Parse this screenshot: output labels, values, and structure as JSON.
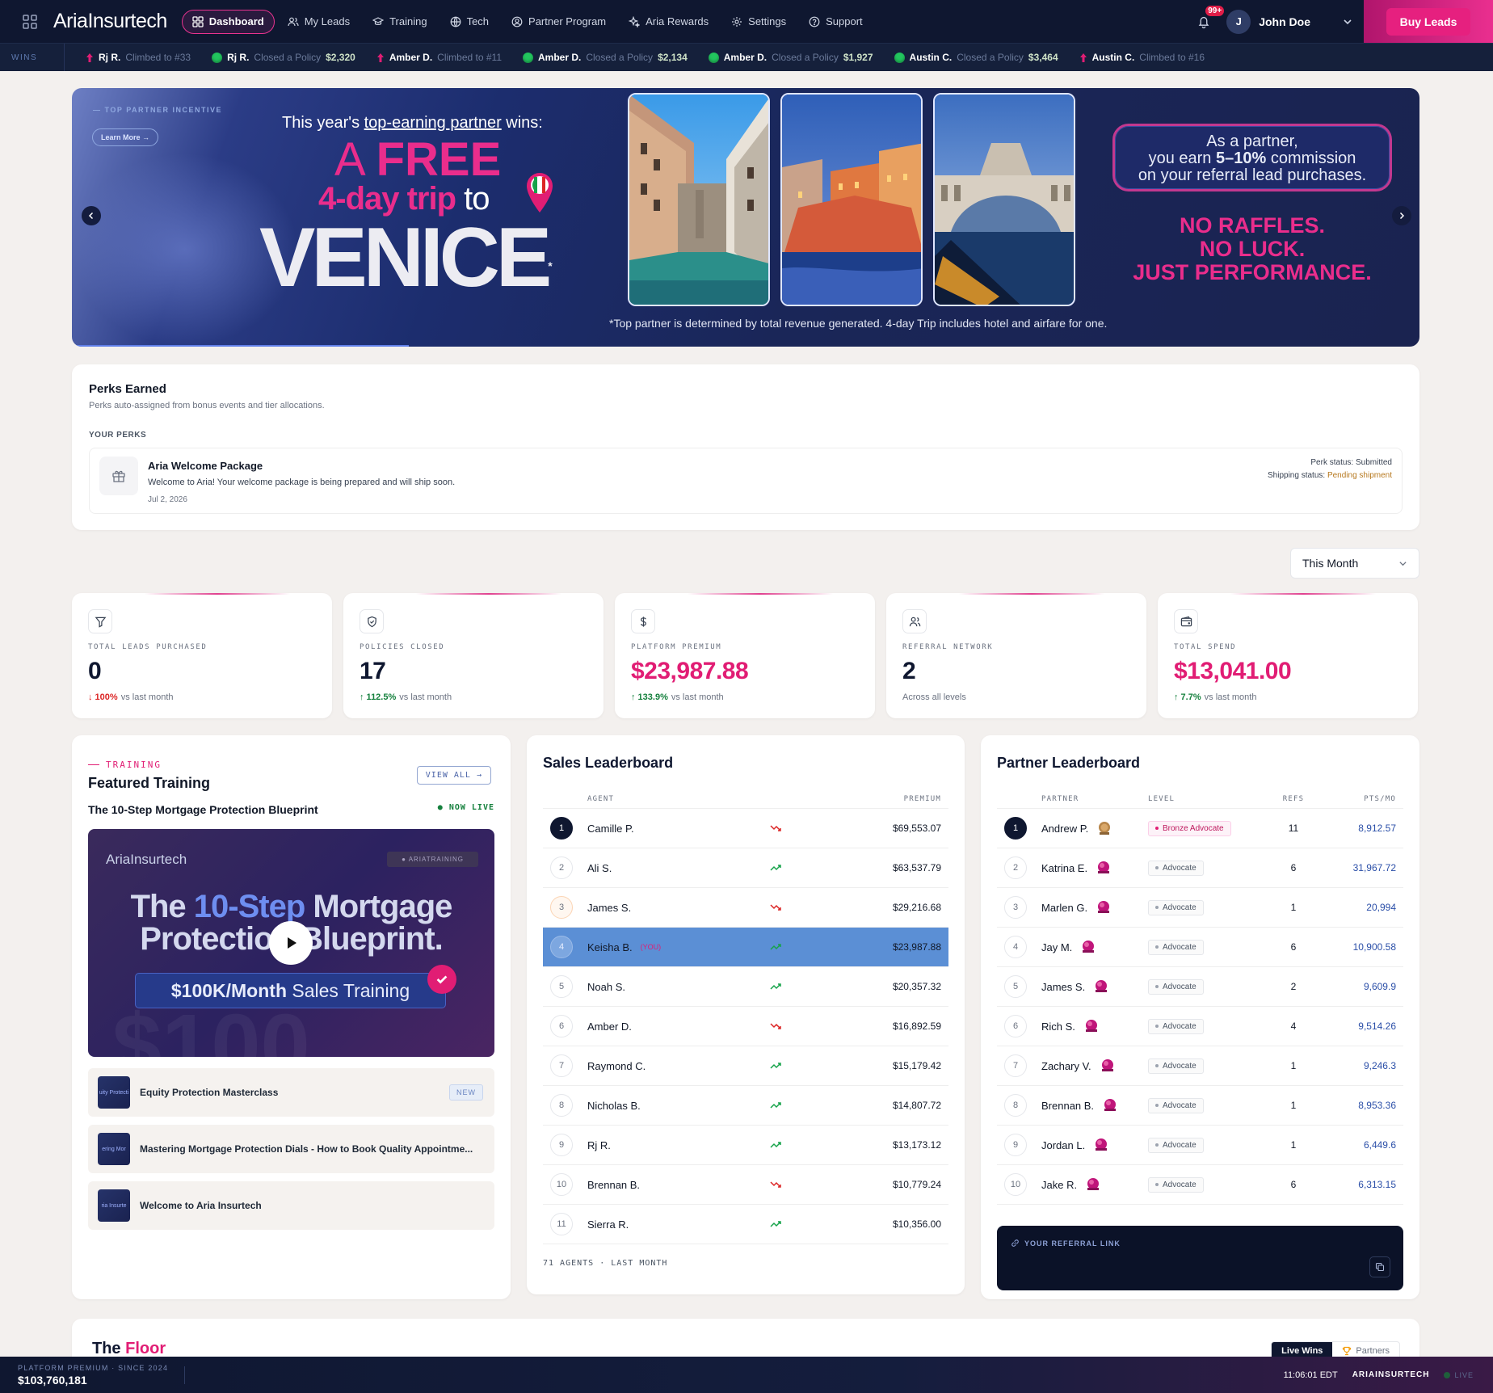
{
  "header": {
    "logo": "AriaInsurtech",
    "nav": [
      {
        "label": "Dashboard",
        "icon": "grid-icon",
        "active": true
      },
      {
        "label": "My Leads",
        "icon": "users-icon"
      },
      {
        "label": "Training",
        "icon": "graduation-icon"
      },
      {
        "label": "Tech",
        "icon": "globe-icon"
      },
      {
        "label": "Partner Program",
        "icon": "partner-icon"
      },
      {
        "label": "Aria Rewards",
        "icon": "sparkle-icon"
      },
      {
        "label": "Settings",
        "icon": "gear-icon"
      },
      {
        "label": "Support",
        "icon": "help-icon"
      }
    ],
    "notifications": "99+",
    "user_initial": "J",
    "user_name": "John Doe",
    "buy_leads": "Buy Leads"
  },
  "ticker": {
    "label": "WINS",
    "items": [
      {
        "type": "climb",
        "name": "Rj R.",
        "text": "Climbed to #33",
        "amount": ""
      },
      {
        "type": "close",
        "name": "Rj R.",
        "text": "Closed a Policy",
        "amount": "$2,320"
      },
      {
        "type": "climb",
        "name": "Amber D.",
        "text": "Climbed to #11",
        "amount": ""
      },
      {
        "type": "close",
        "name": "Amber D.",
        "text": "Closed a Policy",
        "amount": "$2,134"
      },
      {
        "type": "close",
        "name": "Amber D.",
        "text": "Closed a Policy",
        "amount": "$1,927"
      },
      {
        "type": "close",
        "name": "Austin C.",
        "text": "Closed a Policy",
        "amount": "$3,464"
      },
      {
        "type": "climb",
        "name": "Austin C.",
        "text": "Climbed to #16",
        "amount": ""
      }
    ]
  },
  "banner": {
    "eyebrow": "TOP PARTNER INCENTIVE",
    "learn_more": "Learn More →",
    "line1_pre": "This year's ",
    "line1_link": "top-earning partner",
    "line1_post": " wins:",
    "line2_a": "A ",
    "line2_b": "FREE",
    "line3_a": "4-day trip",
    "line3_b": " to",
    "line4": "VENICE",
    "asterisk": "*",
    "footnote": "*Top partner is determined by total revenue generated. 4-day Trip includes hotel and airfare for one.",
    "partner_1": "As a partner,",
    "partner_2a": "you earn ",
    "partner_2b": "5–10%",
    "partner_2c": " commission",
    "partner_3": "on your referral lead purchases.",
    "slogan_1": "NO RAFFLES.",
    "slogan_2": "NO LUCK.",
    "slogan_3": "JUST PERFORMANCE.",
    "slide_progress": 0.25
  },
  "perks": {
    "title": "Perks Earned",
    "subtitle": "Perks auto-assigned from bonus events and tier allocations.",
    "section": "YOUR PERKS",
    "item": {
      "title": "Aria Welcome Package",
      "desc": "Welcome to Aria! Your welcome package is being prepared and will ship soon.",
      "date": "Jul 2, 2026",
      "status_label": "Perk status: ",
      "status": "Submitted",
      "ship_label": "Shipping status: ",
      "ship": "Pending shipment"
    }
  },
  "period": "This Month",
  "stats": [
    {
      "icon": "funnel-icon",
      "label": "TOTAL LEADS PURCHASED",
      "value": "0",
      "pink": false,
      "dir": "down",
      "change": "100%",
      "suffix": "vs last month"
    },
    {
      "icon": "shield-icon",
      "label": "POLICIES CLOSED",
      "value": "17",
      "pink": false,
      "dir": "up",
      "change": "112.5%",
      "suffix": "vs last month"
    },
    {
      "icon": "dollar-icon",
      "label": "PLATFORM PREMIUM",
      "value": "$23,987.88",
      "pink": true,
      "dir": "up",
      "change": "133.9%",
      "suffix": "vs last month"
    },
    {
      "icon": "people-icon",
      "label": "REFERRAL NETWORK",
      "value": "2",
      "pink": false,
      "dir": "",
      "change": "",
      "suffix": "Across all levels"
    },
    {
      "icon": "wallet-icon",
      "label": "TOTAL SPEND",
      "value": "$13,041.00",
      "pink": true,
      "dir": "up",
      "change": "7.7%",
      "suffix": "vs last month"
    }
  ],
  "training": {
    "eyebrow": "TRAINING",
    "title": "Featured Training",
    "view_all": "VIEW ALL →",
    "featured": "The 10-Step Mortgage Protection Blueprint",
    "now_live": "● NOW LIVE",
    "video_logo": "AriaInsurtech",
    "video_tag": "● ARIATRAINING",
    "video_h1a": "The ",
    "video_h1b": "10-Step",
    "video_h1c": " Mortgage",
    "video_h2": "Protection Blueprint.",
    "video_pill_a": "$100K/Month",
    "video_pill_b": " Sales Training",
    "video_bg": "$100",
    "courses": [
      {
        "title": "Equity Protection Masterclass",
        "thumb": "uity Protecti",
        "badge": "NEW"
      },
      {
        "title": "Mastering Mortgage Protection Dials - How to Book Quality Appointme...",
        "thumb": "ering Mor",
        "badge": ""
      },
      {
        "title": "Welcome to Aria Insurtech",
        "thumb": "ria Insurte",
        "badge": ""
      }
    ]
  },
  "sales": {
    "title": "Sales Leaderboard",
    "col_agent": "AGENT",
    "col_premium": "PREMIUM",
    "you_tag": "(YOU)",
    "rows": [
      {
        "rank": "1",
        "name": "Camille P.",
        "trend": "down",
        "premium": "$69,553.07",
        "you": false
      },
      {
        "rank": "2",
        "name": "Ali S.",
        "trend": "up",
        "premium": "$63,537.79",
        "you": false
      },
      {
        "rank": "3",
        "name": "James S.",
        "trend": "down",
        "premium": "$29,216.68",
        "you": false
      },
      {
        "rank": "4",
        "name": "Keisha B.",
        "trend": "up",
        "premium": "$23,987.88",
        "you": true
      },
      {
        "rank": "5",
        "name": "Noah S.",
        "trend": "up",
        "premium": "$20,357.32",
        "you": false
      },
      {
        "rank": "6",
        "name": "Amber D.",
        "trend": "down",
        "premium": "$16,892.59",
        "you": false
      },
      {
        "rank": "7",
        "name": "Raymond C.",
        "trend": "up",
        "premium": "$15,179.42",
        "you": false
      },
      {
        "rank": "8",
        "name": "Nicholas B.",
        "trend": "up",
        "premium": "$14,807.72",
        "you": false
      },
      {
        "rank": "9",
        "name": "Rj R.",
        "trend": "up",
        "premium": "$13,173.12",
        "you": false
      },
      {
        "rank": "10",
        "name": "Brennan B.",
        "trend": "down",
        "premium": "$10,779.24",
        "you": false
      },
      {
        "rank": "11",
        "name": "Sierra R.",
        "trend": "up",
        "premium": "$10,356.00",
        "you": false
      }
    ],
    "footer": "71 AGENTS · LAST MONTH"
  },
  "partners": {
    "title": "Partner Leaderboard",
    "col_partner": "PARTNER",
    "col_level": "LEVEL",
    "col_refs": "REFS",
    "col_pts": "PTS/MO",
    "rows": [
      {
        "rank": "1",
        "name": "Andrew P.",
        "medal": "bronze",
        "level": "Bronze Advocate",
        "refs": "11",
        "pts": "8,912.57"
      },
      {
        "rank": "2",
        "name": "Katrina E.",
        "medal": "advocate",
        "level": "Advocate",
        "refs": "6",
        "pts": "31,967.72"
      },
      {
        "rank": "3",
        "name": "Marlen G.",
        "medal": "advocate",
        "level": "Advocate",
        "refs": "1",
        "pts": "20,994"
      },
      {
        "rank": "4",
        "name": "Jay M.",
        "medal": "advocate",
        "level": "Advocate",
        "refs": "6",
        "pts": "10,900.58"
      },
      {
        "rank": "5",
        "name": "James S.",
        "medal": "advocate",
        "level": "Advocate",
        "refs": "2",
        "pts": "9,609.9"
      },
      {
        "rank": "6",
        "name": "Rich S.",
        "medal": "advocate",
        "level": "Advocate",
        "refs": "4",
        "pts": "9,514.26"
      },
      {
        "rank": "7",
        "name": "Zachary V.",
        "medal": "advocate",
        "level": "Advocate",
        "refs": "1",
        "pts": "9,246.3"
      },
      {
        "rank": "8",
        "name": "Brennan B.",
        "medal": "advocate",
        "level": "Advocate",
        "refs": "1",
        "pts": "8,953.36"
      },
      {
        "rank": "9",
        "name": "Jordan L.",
        "medal": "advocate",
        "level": "Advocate",
        "refs": "1",
        "pts": "6,449.6"
      },
      {
        "rank": "10",
        "name": "Jake R.",
        "medal": "advocate",
        "level": "Advocate",
        "refs": "6",
        "pts": "6,313.15"
      }
    ],
    "referral_label": "YOUR REFERRAL LINK"
  },
  "floor": {
    "title_a": "The ",
    "title_b": "Floor",
    "tab_live": "Live Wins",
    "tab_partners": "Partners"
  },
  "footer": {
    "label": "PLATFORM PREMIUM · SINCE 2024",
    "value": "$103,760,181",
    "time": "11:06:01 EDT",
    "brand": "ARIAINSURTECH",
    "live": "LIVE"
  }
}
